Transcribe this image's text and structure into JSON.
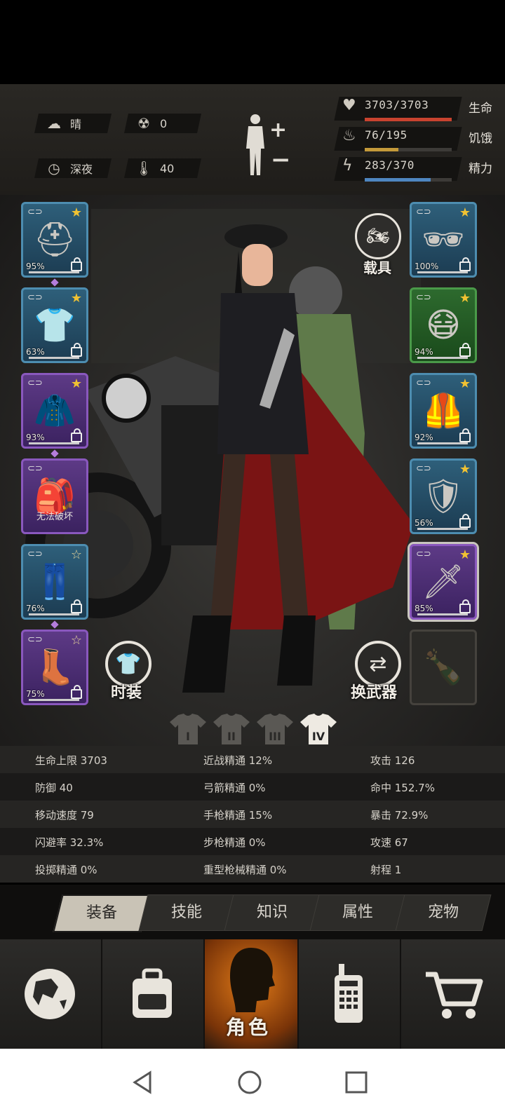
{
  "status": {
    "weather": "晴",
    "radiation": "0",
    "time_of_day": "深夜",
    "temperature": "40",
    "bars": [
      {
        "label": "生命",
        "value": "3703/3703",
        "fraction": 1.0,
        "color": "#c9432f",
        "icon": "heart-pulse-icon"
      },
      {
        "label": "饥饿",
        "value": "76/195",
        "fraction": 0.39,
        "color": "#c49a3a",
        "icon": "stomach-icon"
      },
      {
        "label": "精力",
        "value": "283/370",
        "fraction": 0.76,
        "color": "#4e86c0",
        "icon": "energy-icon"
      }
    ]
  },
  "left_slots": [
    {
      "name": "helmet-slot",
      "rarity": "blue",
      "pct": "95%",
      "star": "filled",
      "icon": "helmet-icon"
    },
    {
      "name": "shirt-slot",
      "rarity": "blue",
      "pct": "63%",
      "star": "filled",
      "icon": "shirt-icon"
    },
    {
      "name": "jacket-slot",
      "rarity": "purple",
      "pct": "93%",
      "star": "filled",
      "icon": "jacket-icon"
    },
    {
      "name": "backpack-slot",
      "rarity": "purple",
      "pct": "",
      "label": "无法破坏",
      "star": "none",
      "icon": "backpack-icon"
    },
    {
      "name": "pants-slot",
      "rarity": "blue",
      "pct": "76%",
      "star": "hollow",
      "icon": "pants-icon"
    },
    {
      "name": "boots-slot",
      "rarity": "purple",
      "pct": "75%",
      "star": "hollow",
      "icon": "boots-icon"
    }
  ],
  "right_slots": [
    {
      "name": "glasses-slot",
      "rarity": "blue",
      "pct": "100%",
      "star": "filled",
      "icon": "sunglasses-icon"
    },
    {
      "name": "mask-slot",
      "rarity": "green",
      "pct": "94%",
      "star": "filled",
      "icon": "mask-icon"
    },
    {
      "name": "vest-slot",
      "rarity": "blue",
      "pct": "92%",
      "star": "filled",
      "icon": "vest-icon"
    },
    {
      "name": "shield-slot",
      "rarity": "blue",
      "pct": "56%",
      "star": "filled",
      "icon": "shield-icon"
    },
    {
      "name": "weapon-slot",
      "rarity": "purple",
      "pct": "85%",
      "star": "filled",
      "icon": "machete-icon"
    },
    {
      "name": "secondary-weapon-slot",
      "rarity": "empty",
      "pct": "",
      "star": "none",
      "icon": "bottle-icon"
    }
  ],
  "buttons": {
    "vehicle": "载具",
    "outfit": "时装",
    "switch_weapon": "换武器"
  },
  "outfit_presets": [
    "I",
    "II",
    "III",
    "IV"
  ],
  "stats": [
    [
      "生命上限 3703",
      "近战精通 12%",
      "攻击 126"
    ],
    [
      "防御 40",
      "弓箭精通 0%",
      "命中 152.7%"
    ],
    [
      "移动速度 79",
      "手枪精通 15%",
      "暴击 72.9%"
    ],
    [
      "闪避率 32.3%",
      "步枪精通 0%",
      "攻速 67"
    ],
    [
      "投掷精通 0%",
      "重型枪械精通 0%",
      "射程 1"
    ]
  ],
  "tabs": [
    "装备",
    "技能",
    "知识",
    "属性",
    "宠物"
  ],
  "nav": {
    "character_label": "角色"
  }
}
